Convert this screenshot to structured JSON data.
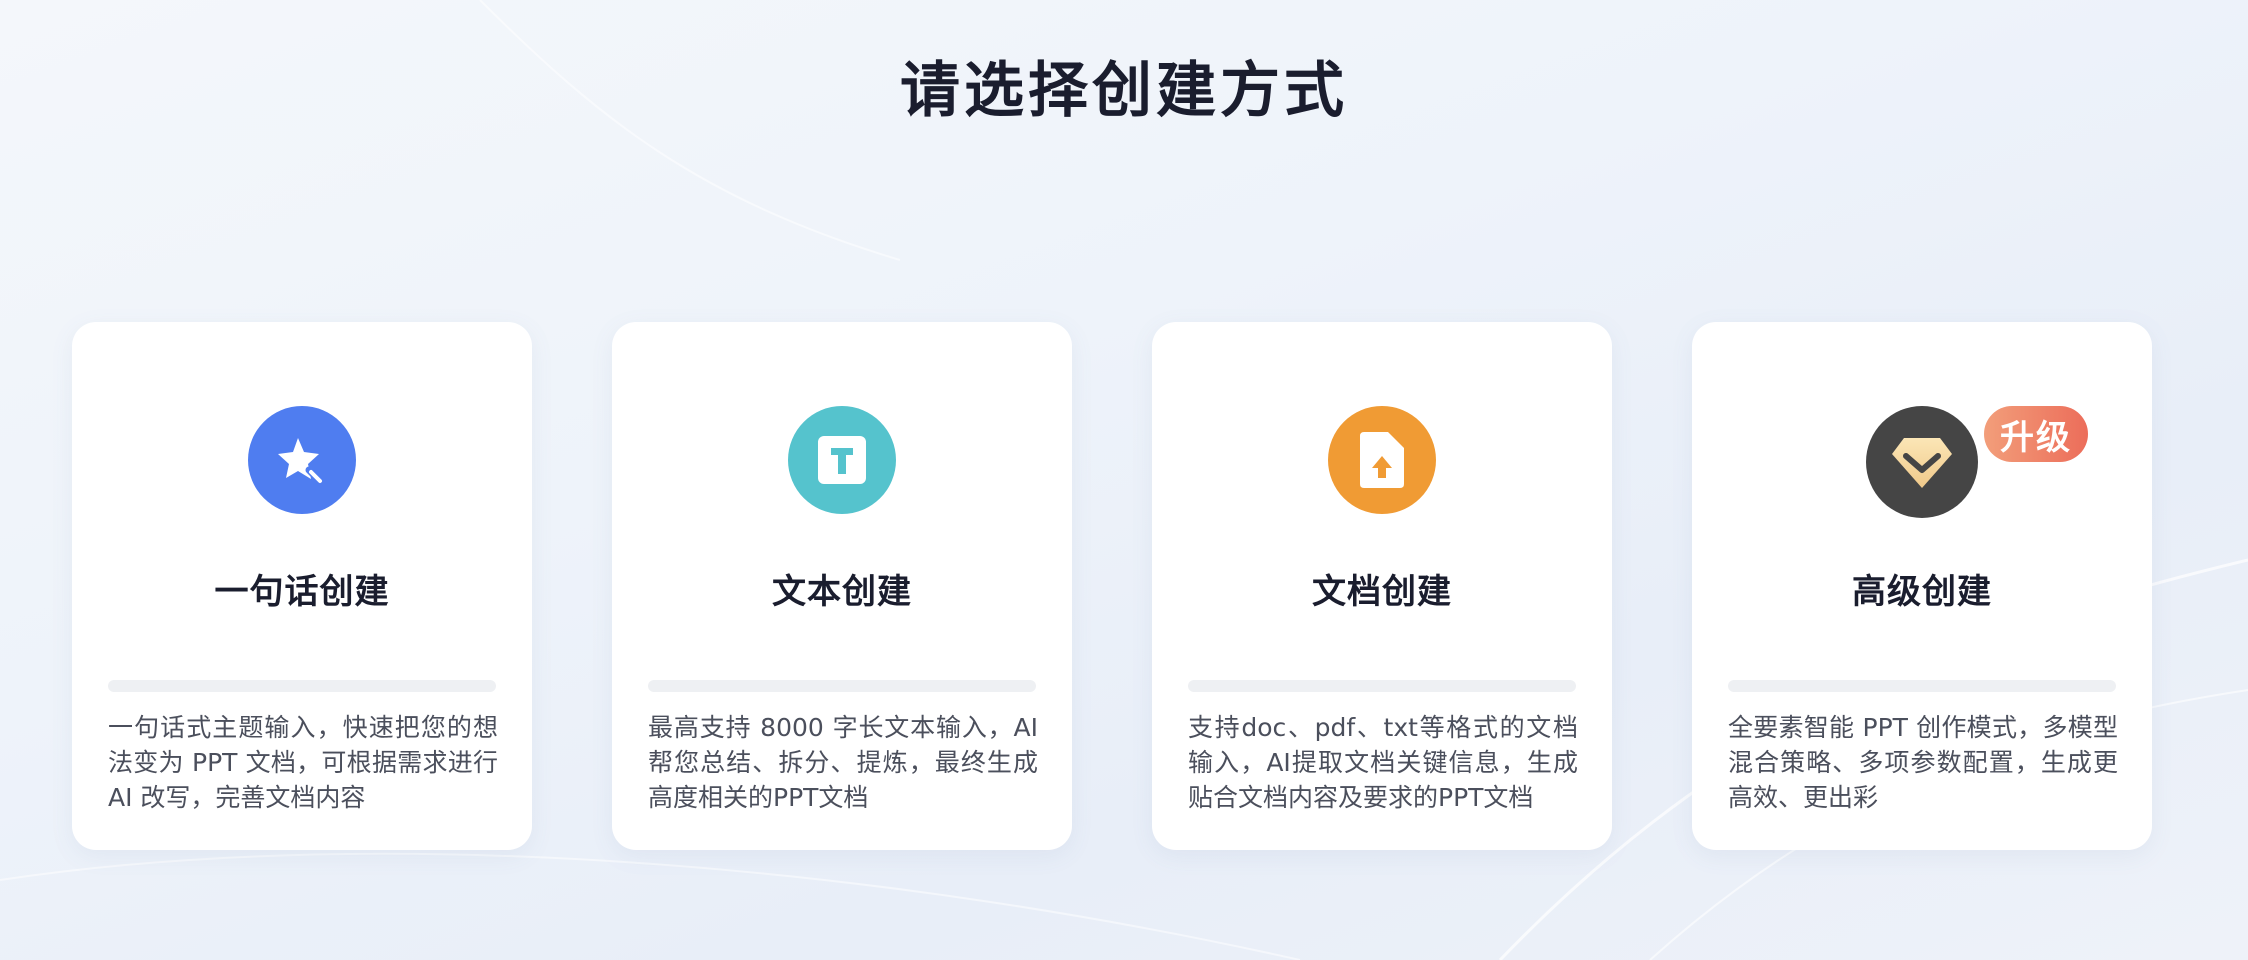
{
  "header": {
    "title": "请选择创建方式"
  },
  "cards": [
    {
      "title": "一句话创建",
      "description": "一句话式主题输入，快速把您的想法变为 PPT 文档，可根据需求进行 AI 改写，完善文档内容",
      "icon": "magic-star-icon",
      "color": "#4f7df0"
    },
    {
      "title": "文本创建",
      "description": "最高支持 8000 字长文本输入，AI 帮您总结、拆分、提炼，最终生成高度相关的PPT文档",
      "icon": "text-t-icon",
      "color": "#55c3cd"
    },
    {
      "title": "文档创建",
      "description": "支持doc、pdf、txt等格式的文档输入，AI提取文档关键信息，生成贴合文档内容及要求的PPT文档",
      "icon": "file-upload-icon",
      "color": "#f09b34"
    },
    {
      "title": "高级创建",
      "description": "全要素智能 PPT 创作模式，多模型混合策略、多项参数配置，生成更高效、更出彩",
      "icon": "diamond-icon",
      "color": "#454545",
      "badge": "升级"
    }
  ]
}
